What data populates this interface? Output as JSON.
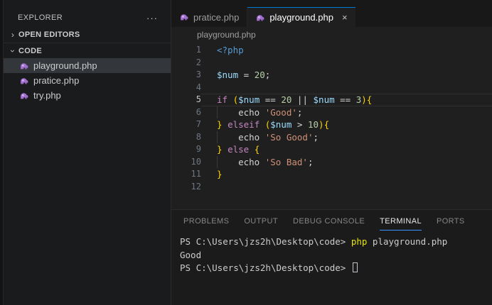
{
  "colors": {
    "accent_blue": "#0078d4",
    "php_icon_purple": "#a36fd1",
    "php_icon_light": "#cfaff0",
    "terminal_command_yellow": "#e5e510",
    "keyword_purple": "#c586c0",
    "string_orange": "#ce9178",
    "number_green": "#b5cea8",
    "variable_blue": "#9cdcfe",
    "bracket_gold": "#ffd700",
    "php_tag_blue": "#569cd6"
  },
  "sidebar": {
    "title": "EXPLORER",
    "more_label": "···",
    "sections": [
      {
        "label": "OPEN EDITORS",
        "collapsed": true
      },
      {
        "label": "CODE",
        "collapsed": false
      }
    ],
    "files": [
      {
        "name": "playground.php",
        "selected": true
      },
      {
        "name": "pratice.php",
        "selected": false
      },
      {
        "name": "try.php",
        "selected": false
      }
    ]
  },
  "tabs": [
    {
      "label": "pratice.php",
      "active": false,
      "close": ""
    },
    {
      "label": "playground.php",
      "active": true,
      "close": "×"
    }
  ],
  "breadcrumb": {
    "label": "playground.php"
  },
  "editor": {
    "active_line": 5,
    "lines": [
      {
        "n": 1,
        "tokens": [
          {
            "t": "<?php",
            "c": "tag"
          }
        ]
      },
      {
        "n": 2,
        "tokens": []
      },
      {
        "n": 3,
        "tokens": [
          {
            "t": "$num",
            "c": "var"
          },
          {
            "t": " = ",
            "c": "def"
          },
          {
            "t": "20",
            "c": "num"
          },
          {
            "t": ";",
            "c": "def"
          }
        ]
      },
      {
        "n": 4,
        "tokens": []
      },
      {
        "n": 5,
        "tokens": [
          {
            "t": "if",
            "c": "kw"
          },
          {
            "t": " ",
            "c": "def"
          },
          {
            "t": "(",
            "c": "br"
          },
          {
            "t": "$num",
            "c": "var"
          },
          {
            "t": " == ",
            "c": "def"
          },
          {
            "t": "20",
            "c": "num"
          },
          {
            "t": " || ",
            "c": "def"
          },
          {
            "t": "$num",
            "c": "var"
          },
          {
            "t": " == ",
            "c": "def"
          },
          {
            "t": "3",
            "c": "num"
          },
          {
            "t": ")",
            "c": "br"
          },
          {
            "t": "{",
            "c": "br"
          }
        ]
      },
      {
        "n": 6,
        "guide": true,
        "tokens": [
          {
            "t": "    echo ",
            "c": "def"
          },
          {
            "t": "'Good'",
            "c": "str"
          },
          {
            "t": ";",
            "c": "def"
          }
        ]
      },
      {
        "n": 7,
        "tokens": [
          {
            "t": "}",
            "c": "br"
          },
          {
            "t": " ",
            "c": "def"
          },
          {
            "t": "elseif",
            "c": "kw"
          },
          {
            "t": " ",
            "c": "def"
          },
          {
            "t": "(",
            "c": "br"
          },
          {
            "t": "$num",
            "c": "var"
          },
          {
            "t": " > ",
            "c": "def"
          },
          {
            "t": "10",
            "c": "num"
          },
          {
            "t": ")",
            "c": "br"
          },
          {
            "t": "{",
            "c": "br"
          }
        ]
      },
      {
        "n": 8,
        "guide": true,
        "tokens": [
          {
            "t": "    echo ",
            "c": "def"
          },
          {
            "t": "'So Good'",
            "c": "str"
          },
          {
            "t": ";",
            "c": "def"
          }
        ]
      },
      {
        "n": 9,
        "tokens": [
          {
            "t": "}",
            "c": "br"
          },
          {
            "t": " ",
            "c": "def"
          },
          {
            "t": "else",
            "c": "kw"
          },
          {
            "t": " ",
            "c": "def"
          },
          {
            "t": "{",
            "c": "br"
          }
        ]
      },
      {
        "n": 10,
        "guide": true,
        "tokens": [
          {
            "t": "    echo ",
            "c": "def"
          },
          {
            "t": "'So Bad'",
            "c": "str"
          },
          {
            "t": ";",
            "c": "def"
          }
        ]
      },
      {
        "n": 11,
        "tokens": [
          {
            "t": "}",
            "c": "br"
          }
        ]
      },
      {
        "n": 12,
        "tokens": []
      }
    ]
  },
  "panel": {
    "tabs": [
      {
        "label": "PROBLEMS",
        "active": false
      },
      {
        "label": "OUTPUT",
        "active": false
      },
      {
        "label": "DEBUG CONSOLE",
        "active": false
      },
      {
        "label": "TERMINAL",
        "active": true
      },
      {
        "label": "PORTS",
        "active": false
      }
    ],
    "terminal_lines": [
      {
        "spans": [
          {
            "t": "PS C:\\Users\\jzs2h\\Desktop\\code> ",
            "c": "fg"
          },
          {
            "t": "php",
            "c": "cmd"
          },
          {
            "t": " playground.php",
            "c": "fg"
          }
        ]
      },
      {
        "spans": [
          {
            "t": "Good",
            "c": "fg"
          }
        ]
      },
      {
        "spans": [
          {
            "t": "PS C:\\Users\\jzs2h\\Desktop\\code> ",
            "c": "fg"
          },
          {
            "t": "",
            "c": "cursor"
          }
        ]
      }
    ]
  }
}
